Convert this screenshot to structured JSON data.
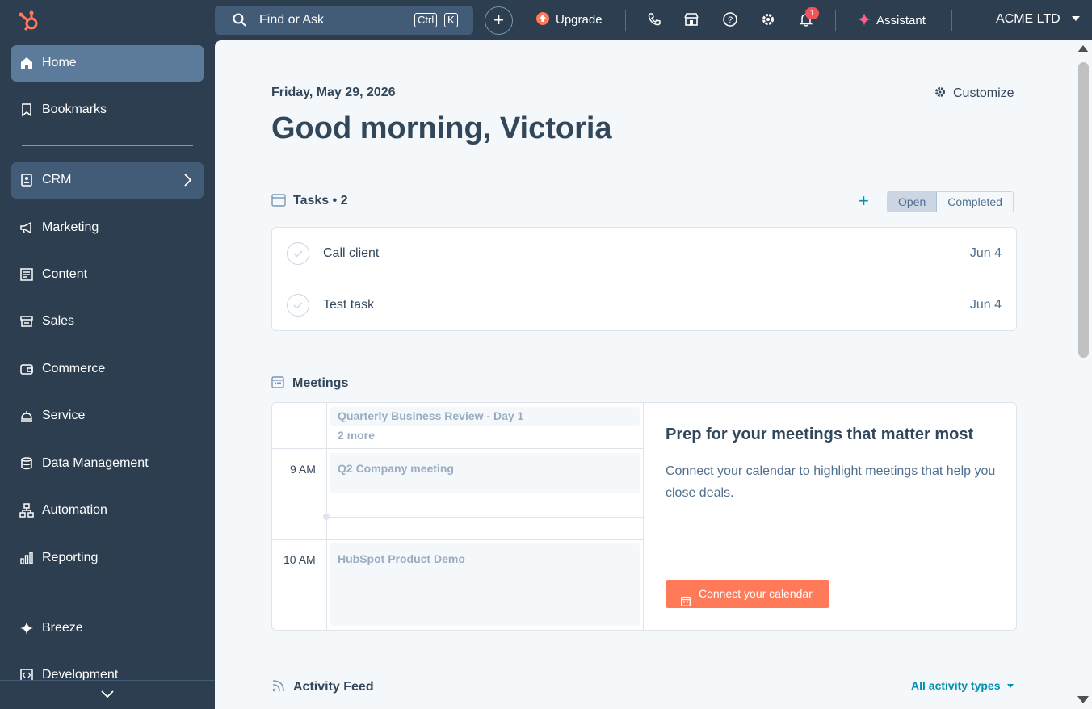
{
  "topbar": {
    "search_text": "Find or Ask",
    "search_kbd1": "Ctrl",
    "search_kbd2": "K",
    "plus": "+",
    "upgrade_label": "Upgrade",
    "notif_count": "1",
    "assistant_label": "Assistant",
    "account_name": "ACME LTD"
  },
  "sidebar": {
    "items": [
      {
        "label": "Home",
        "icon": "home-icon"
      },
      {
        "label": "Bookmarks",
        "icon": "bookmark-icon"
      },
      {
        "label": "CRM",
        "icon": "contacts-book-icon"
      },
      {
        "label": "Marketing",
        "icon": "megaphone-icon"
      },
      {
        "label": "Content",
        "icon": "content-icon"
      },
      {
        "label": "Sales",
        "icon": "sales-icon"
      },
      {
        "label": "Commerce",
        "icon": "wallet-icon"
      },
      {
        "label": "Service",
        "icon": "service-bell-icon"
      },
      {
        "label": "Data Management",
        "icon": "database-icon"
      },
      {
        "label": "Automation",
        "icon": "workflow-icon"
      },
      {
        "label": "Reporting",
        "icon": "bar-chart-icon"
      },
      {
        "label": "Breeze",
        "icon": "sparkle-icon"
      },
      {
        "label": "Development",
        "icon": "code-icon"
      }
    ]
  },
  "main": {
    "date": "Friday, May 29, 2026",
    "greeting": "Good morning, Victoria",
    "customize_label": "Customize",
    "tasks": {
      "header": "Tasks • 2",
      "add": "+",
      "toggle_open": "Open",
      "toggle_completed": "Completed",
      "items": [
        {
          "name": "Call client",
          "due": "Jun 4"
        },
        {
          "name": "Test task",
          "due": "Jun 4"
        }
      ]
    },
    "meetings": {
      "header": "Meetings",
      "times": [
        "9 AM",
        "10 AM"
      ],
      "events": [
        "Quarterly Business Review - Day 1",
        "Q2 Company meeting",
        "HubSpot Product Demo"
      ],
      "more": "2 more",
      "prep_title": "Prep for your meetings that matter most",
      "prep_text": "Connect your calendar to highlight meetings that help you close deals.",
      "connect_label": "Connect your calendar"
    },
    "activity": {
      "header": "Activity Feed",
      "filter": "All activity types"
    }
  },
  "colors": {
    "nav_bg": "#2d3e50",
    "accent_orange": "#ff7a59",
    "link_teal": "#0091ae",
    "active_nav": "#5c7a99"
  }
}
